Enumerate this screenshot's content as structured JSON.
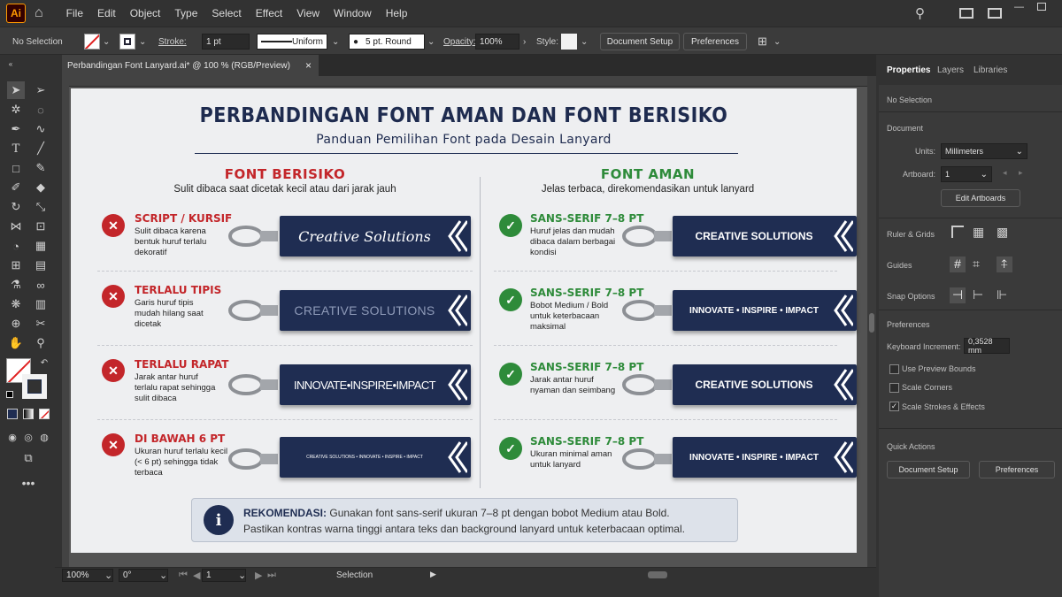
{
  "app": {
    "logo": "Ai",
    "menus": [
      "File",
      "Edit",
      "Object",
      "Type",
      "Select",
      "Effect",
      "View",
      "Window",
      "Help"
    ]
  },
  "control": {
    "selection": "No Selection",
    "stroke_label": "Stroke:",
    "stroke_value": "1 pt",
    "stroke_profile": "Uniform",
    "brush": "5 pt. Round",
    "opacity_label": "Opacity:",
    "opacity_value": "100%",
    "style_label": "Style:",
    "doc_setup": "Document Setup",
    "preferences": "Preferences"
  },
  "tab": {
    "title": "Perbandingan Font Lanyard.ai* @ 100 % (RGB/Preview)",
    "close": "×"
  },
  "status": {
    "zoom": "100%",
    "rotate": "0°",
    "artboard": "1",
    "tool": "Selection"
  },
  "panel": {
    "tabs": [
      "Properties",
      "Layers",
      "Libraries"
    ],
    "no_selection": "No Selection",
    "document": "Document",
    "units_label": "Units:",
    "units_value": "Millimeters",
    "artboard_label": "Artboard:",
    "artboard_value": "1",
    "edit_artboards": "Edit Artboards",
    "ruler_grids": "Ruler & Grids",
    "guides": "Guides",
    "snap_options": "Snap Options",
    "preferences_title": "Preferences",
    "keyboard_label": "Keyboard Increment:",
    "keyboard_value": "0,3528 mm",
    "checks": [
      {
        "label": "Use Preview Bounds",
        "checked": false
      },
      {
        "label": "Scale Corners",
        "checked": false
      },
      {
        "label": "Scale Strokes & Effects",
        "checked": true
      }
    ],
    "quick_actions": "Quick Actions",
    "qa_doc_setup": "Document Setup",
    "qa_preferences": "Preferences"
  },
  "artboard": {
    "title": "PERBANDINGAN FONT AMAN DAN FONT BERISIKO",
    "subtitle": "Panduan Pemilihan Font pada Desain Lanyard",
    "left_head": "FONT BERISIKO",
    "left_sub": "Sulit dibaca saat dicetak kecil atau dari jarak jauh",
    "right_head": "FONT AMAN",
    "right_sub": "Jelas terbaca, direkomendasikan untuk lanyard",
    "risky": [
      {
        "title": "SCRIPT / KURSIF",
        "desc": "Sulit dibaca karena bentuk huruf terlalu dekoratif",
        "lanyard": "Creative Solutions"
      },
      {
        "title": "TERLALU TIPIS",
        "desc": "Garis huruf tipis mudah hilang saat dicetak",
        "lanyard": "CREATIVE SOLUTIONS"
      },
      {
        "title": "TERLALU RAPAT",
        "desc": "Jarak antar huruf terlalu rapat sehingga sulit dibaca",
        "lanyard": "INNOVATE•INSPIRE•IMPACT"
      },
      {
        "title": "DI BAWAH 6 PT",
        "desc": "Ukuran huruf terlalu kecil (< 6 pt) sehingga tidak terbaca",
        "lanyard": "CREATIVE SOLUTIONS • INNOVATE • INSPIRE • IMPACT"
      }
    ],
    "safe": [
      {
        "title": "SANS-SERIF 7–8 PT",
        "desc": "Huruf jelas dan mudah dibaca dalam berbagai kondisi",
        "lanyard": "CREATIVE SOLUTIONS"
      },
      {
        "title": "SANS-SERIF 7–8 PT",
        "desc": "Bobot Medium / Bold untuk keterbacaan maksimal",
        "lanyard": "INNOVATE • INSPIRE • IMPACT"
      },
      {
        "title": "SANS-SERIF 7–8 PT",
        "desc": "Jarak antar huruf nyaman dan seimbang",
        "lanyard": "CREATIVE SOLUTIONS"
      },
      {
        "title": "SANS-SERIF 7–8 PT",
        "desc": "Ukuran minimal aman untuk lanyard",
        "lanyard": "INNOVATE • INSPIRE • IMPACT"
      }
    ],
    "rec_label": "REKOMENDASI:",
    "rec_line1": "Gunakan font sans-serif ukuran 7–8 pt dengan bobot Medium atau Bold.",
    "rec_line2": "Pastikan kontras warna tinggi antara teks dan background lanyard untuk keterbacaan optimal."
  },
  "colors": {
    "navy": "#1f2d52",
    "red": "#c3262a",
    "green": "#2e8b3a",
    "accent": "#ff9a00"
  }
}
